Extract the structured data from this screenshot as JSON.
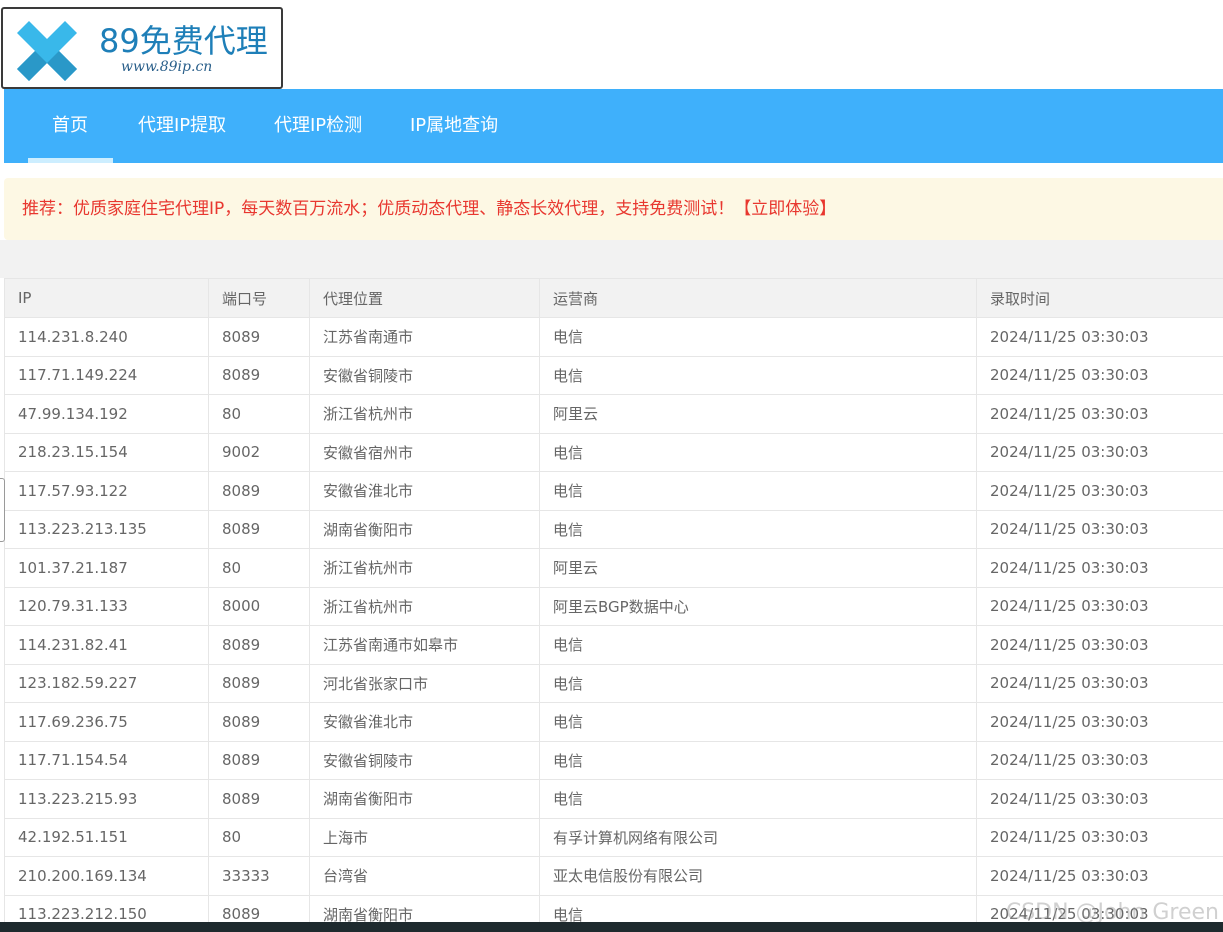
{
  "logo": {
    "title": "89免费代理",
    "url": "www.89ip.cn",
    "colors": {
      "mark_light": "#39b8ea",
      "mark_dark": "#2a98c8"
    }
  },
  "nav": {
    "items": [
      {
        "label": "首页",
        "active": true
      },
      {
        "label": "代理IP提取",
        "active": false
      },
      {
        "label": "代理IP检测",
        "active": false
      },
      {
        "label": "IP属地查询",
        "active": false
      }
    ],
    "background": "#3fb0fb"
  },
  "recommend": {
    "text": "推荐：优质家庭住宅代理IP，每天数百万流水；优质动态代理、静态长效代理，支持免费测试！【立即体验】",
    "color": "#e8372f"
  },
  "table": {
    "headers": [
      "IP",
      "端口号",
      "代理位置",
      "运营商",
      "录取时间"
    ],
    "rows": [
      [
        "114.231.8.240",
        "8089",
        "江苏省南通市",
        "电信",
        "2024/11/25 03:30:03"
      ],
      [
        "117.71.149.224",
        "8089",
        "安徽省铜陵市",
        "电信",
        "2024/11/25 03:30:03"
      ],
      [
        "47.99.134.192",
        "80",
        "浙江省杭州市",
        "阿里云",
        "2024/11/25 03:30:03"
      ],
      [
        "218.23.15.154",
        "9002",
        "安徽省宿州市",
        "电信",
        "2024/11/25 03:30:03"
      ],
      [
        "117.57.93.122",
        "8089",
        "安徽省淮北市",
        "电信",
        "2024/11/25 03:30:03"
      ],
      [
        "113.223.213.135",
        "8089",
        "湖南省衡阳市",
        "电信",
        "2024/11/25 03:30:03"
      ],
      [
        "101.37.21.187",
        "80",
        "浙江省杭州市",
        "阿里云",
        "2024/11/25 03:30:03"
      ],
      [
        "120.79.31.133",
        "8000",
        "浙江省杭州市",
        "阿里云BGP数据中心",
        "2024/11/25 03:30:03"
      ],
      [
        "114.231.82.41",
        "8089",
        "江苏省南通市如皋市",
        "电信",
        "2024/11/25 03:30:03"
      ],
      [
        "123.182.59.227",
        "8089",
        "河北省张家口市",
        "电信",
        "2024/11/25 03:30:03"
      ],
      [
        "117.69.236.75",
        "8089",
        "安徽省淮北市",
        "电信",
        "2024/11/25 03:30:03"
      ],
      [
        "117.71.154.54",
        "8089",
        "安徽省铜陵市",
        "电信",
        "2024/11/25 03:30:03"
      ],
      [
        "113.223.215.93",
        "8089",
        "湖南省衡阳市",
        "电信",
        "2024/11/25 03:30:03"
      ],
      [
        "42.192.51.151",
        "80",
        "上海市",
        "有孚计算机网络有限公司",
        "2024/11/25 03:30:03"
      ],
      [
        "210.200.169.134",
        "33333",
        "台湾省",
        "亚太电信股份有限公司",
        "2024/11/25 03:30:03"
      ],
      [
        "113.223.212.150",
        "8089",
        "湖南省衡阳市",
        "电信",
        "2024/11/25 03:30:03"
      ]
    ]
  },
  "watermark": "CSDN @John Green"
}
